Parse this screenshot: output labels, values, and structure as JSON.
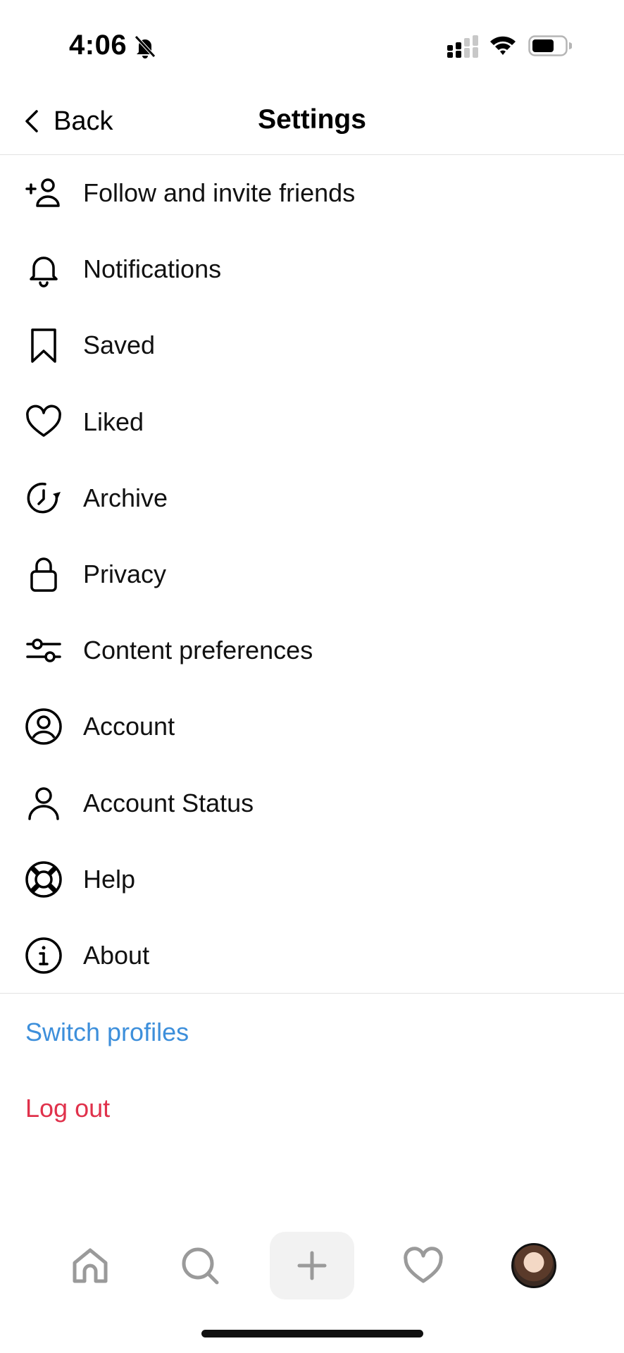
{
  "status_bar": {
    "time": "4:06"
  },
  "nav": {
    "back_label": "Back",
    "title": "Settings"
  },
  "menu": [
    {
      "label": "Follow and invite friends",
      "icon": "add-person-icon"
    },
    {
      "label": "Notifications",
      "icon": "bell-icon"
    },
    {
      "label": "Saved",
      "icon": "bookmark-icon"
    },
    {
      "label": "Liked",
      "icon": "heart-icon"
    },
    {
      "label": "Archive",
      "icon": "archive-clock-icon"
    },
    {
      "label": "Privacy",
      "icon": "lock-icon"
    },
    {
      "label": "Content preferences",
      "icon": "sliders-icon"
    },
    {
      "label": "Account",
      "icon": "account-circle-icon"
    },
    {
      "label": "Account Status",
      "icon": "person-icon"
    },
    {
      "label": "Help",
      "icon": "lifebuoy-icon"
    },
    {
      "label": "About",
      "icon": "info-icon"
    }
  ],
  "actions": {
    "switch_profiles": "Switch profiles",
    "log_out": "Log out"
  },
  "colors": {
    "link": "#3d8fdb",
    "destructive": "#e0314b",
    "inactive_tab_icon": "#9a9a9a"
  },
  "tab_bar": [
    "home-icon",
    "search-icon",
    "plus-icon",
    "heart-icon",
    "avatar"
  ]
}
